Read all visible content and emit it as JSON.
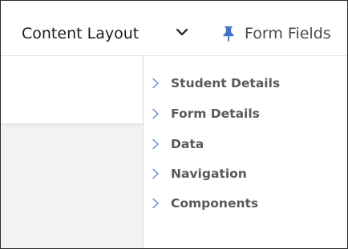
{
  "toolbar": {
    "layout_select_label": "Content Layout",
    "form_fields_label": "Form Fields"
  },
  "tree": {
    "items": [
      {
        "label": "Student Details"
      },
      {
        "label": "Form Details"
      },
      {
        "label": "Data"
      },
      {
        "label": "Navigation"
      },
      {
        "label": "Components"
      }
    ]
  },
  "icons": {
    "layout_chevron": "chevron-down-icon",
    "form_fields": "pin-icon",
    "tree_expand": "chevron-right-icon"
  },
  "colors": {
    "pin_accent": "#4472c4",
    "chevron_accent": "#5b8cd6",
    "tree_text": "#5a5a5a"
  }
}
